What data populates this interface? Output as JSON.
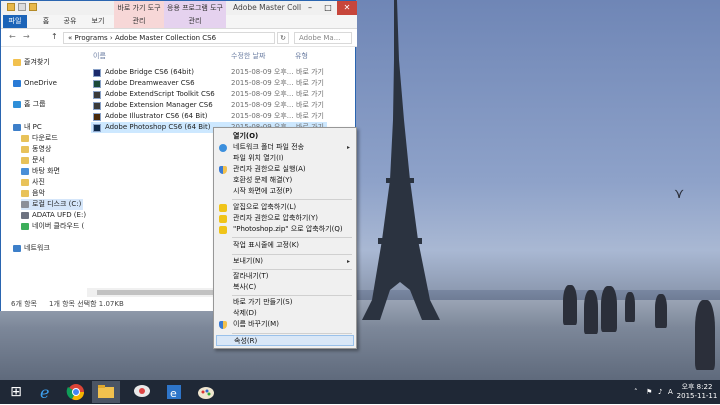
{
  "window": {
    "title": "Adobe Master Coll",
    "ribbon_context_tabs": [
      "바로 가기 도구",
      "응용 프로그램 도구"
    ],
    "ribbon_tabs": [
      "파일",
      "홈",
      "공유",
      "보기",
      "관리",
      "관리"
    ],
    "controls": {
      "minimize": "–",
      "maximize": "□",
      "close": "✕"
    }
  },
  "address": {
    "back": "←",
    "forward": "→",
    "up": "↑",
    "path": "« Programs › Adobe Master Collection CS6",
    "search_placeholder": "Adobe Ma..."
  },
  "nav": {
    "items": [
      {
        "label": "즐겨찾기",
        "icon": "star-icon",
        "color": "#f2c14e"
      },
      {
        "label": "OneDrive",
        "icon": "cloud-icon",
        "color": "#2a7bd6"
      },
      {
        "label": "홈 그룹",
        "icon": "homegroup-icon",
        "color": "#2f8fd8"
      },
      {
        "label": "내 PC",
        "icon": "computer-icon",
        "color": "#3d7fc9"
      },
      {
        "label": "다운로드",
        "icon": "download-folder-icon",
        "color": "#e8c25a"
      },
      {
        "label": "동영상",
        "icon": "video-folder-icon",
        "color": "#e8c25a"
      },
      {
        "label": "문서",
        "icon": "documents-folder-icon",
        "color": "#e8c25a"
      },
      {
        "label": "바탕 화면",
        "icon": "desktop-folder-icon",
        "color": "#4a8fd8"
      },
      {
        "label": "사진",
        "icon": "pictures-folder-icon",
        "color": "#e8c25a"
      },
      {
        "label": "음악",
        "icon": "music-folder-icon",
        "color": "#e8c25a"
      },
      {
        "label": "로컬 디스크 (C:)",
        "icon": "drive-icon",
        "color": "#8a8f99"
      },
      {
        "label": "ADATA UFD (E:)",
        "icon": "usb-drive-icon",
        "color": "#6d7280"
      },
      {
        "label": "네이버 클라우드 (",
        "icon": "cloud-drive-icon",
        "color": "#3cae5a"
      },
      {
        "label": "네트워크",
        "icon": "network-icon",
        "color": "#3d7fc9"
      }
    ]
  },
  "files": {
    "headers": [
      "이름",
      "수정한 날짜",
      "유형"
    ],
    "rows": [
      {
        "name": "Adobe Bridge CS6 (64bit)",
        "date": "2015-08-09 오후...",
        "type": "바로 가기"
      },
      {
        "name": "Adobe Dreamweaver CS6",
        "date": "2015-08-09 오후...",
        "type": "바로 가기"
      },
      {
        "name": "Adobe ExtendScript Toolkit CS6",
        "date": "2015-08-09 오후...",
        "type": "바로 가기"
      },
      {
        "name": "Adobe Extension Manager CS6",
        "date": "2015-08-09 오후...",
        "type": "바로 가기"
      },
      {
        "name": "Adobe Illustrator CS6 (64 Bit)",
        "date": "2015-08-09 오후...",
        "type": "바로 가기"
      },
      {
        "name": "Adobe Photoshop CS6 (64 Bit)",
        "date": "2015-08-09 오후...",
        "type": "바로 가기"
      }
    ]
  },
  "status": {
    "count": "6개 항목",
    "selection": "1개 항목 선택함 1.07KB"
  },
  "context_menu": {
    "items": [
      {
        "label": "열기(O)",
        "bold": true
      },
      {
        "label": "네트워크 폴더 파일 전송",
        "submenu": true,
        "icon": "network-transfer-icon"
      },
      {
        "label": "파일 위치 열기(I)"
      },
      {
        "label": "관리자 권한으로 실행(A)",
        "icon": "shield-icon"
      },
      {
        "label": "호환성 문제 해결(Y)"
      },
      {
        "label": "시작 화면에 고정(P)"
      },
      {
        "label": "알집으로 압축하기(L)",
        "icon": "alzip-icon"
      },
      {
        "label": "관리자 권한으로 압축하기(Y)",
        "icon": "alzip-admin-icon"
      },
      {
        "label": "\"Photoshop.zip\" 으로 압축하기(Q)",
        "icon": "alzip-zip-icon"
      },
      {
        "label": "작업 표시줄에 고정(K)"
      },
      {
        "label": "보내기(N)",
        "submenu": true
      },
      {
        "label": "잘라내기(T)"
      },
      {
        "label": "복사(C)"
      },
      {
        "label": "바로 가기 만들기(S)"
      },
      {
        "label": "삭제(D)"
      },
      {
        "label": "이름 바꾸기(M)",
        "icon": "shield-icon"
      },
      {
        "label": "속성(R)",
        "highlighted": true
      }
    ]
  },
  "taskbar": {
    "start_glyph": "⊞",
    "apps": [
      "internet-explorer-icon",
      "chrome-icon",
      "file-explorer-icon",
      "messenger-icon",
      "alzip-icon",
      "paint-icon"
    ],
    "tray": {
      "up_arrow": "˄",
      "ime": "A",
      "time": "오후 8:22",
      "date": "2015-11-11"
    }
  }
}
